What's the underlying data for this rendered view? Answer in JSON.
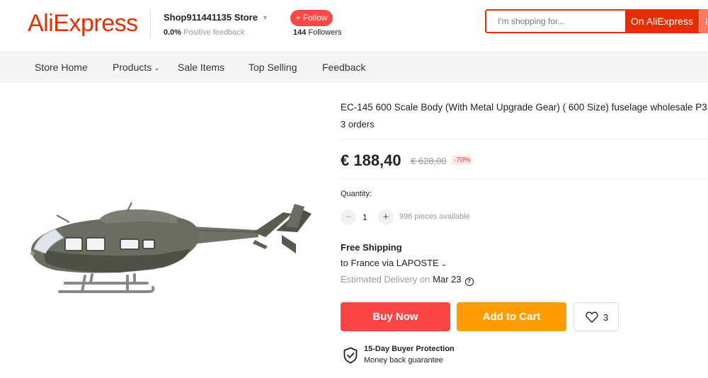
{
  "header": {
    "logo": "AliExpress",
    "store_name": "Shop911441135 Store",
    "feedback_value": "0.0%",
    "feedback_label": "Positive feedback",
    "follow_label": "+ Follow",
    "followers_count": "144",
    "followers_label": "Followers",
    "search_placeholder": "I'm shopping for...",
    "search_ali_label": "On AliExpress",
    "search_store_label": "In this store"
  },
  "nav": {
    "items": [
      "Store Home",
      "Products",
      "Sale Items",
      "Top Selling",
      "Feedback"
    ]
  },
  "product": {
    "title": "EC-145 600 Scale Body (With Metal Upgrade Gear) ( 600 Size) fuselage wholesale P3",
    "orders": "3 orders",
    "price": "€ 188,40",
    "old_price": "€ 628,00",
    "discount": "-70%",
    "quantity_label": "Quantity:",
    "quantity_value": "1",
    "pieces_available": "996 pieces available",
    "shipping_title": "Free Shipping",
    "shipping_to": "to France via LAPOSTE",
    "estimated_label": "Estimated Delivery on",
    "estimated_date": "Mar 23",
    "buy_now": "Buy Now",
    "add_to_cart": "Add to Cart",
    "wish_count": "3",
    "protection_title": "15-Day Buyer Protection",
    "protection_sub": "Money back guarantee"
  },
  "colors": {
    "brand": "#e62e04",
    "buy_now": "#ff4444",
    "add_to_cart": "#ff9c00"
  }
}
